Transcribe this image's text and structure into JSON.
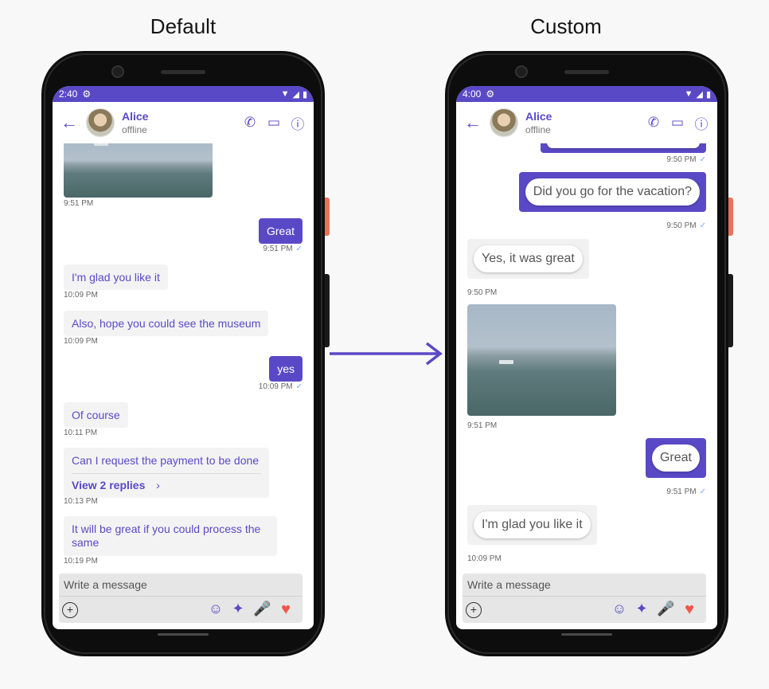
{
  "labels": {
    "left": "Default",
    "right": "Custom"
  },
  "colors": {
    "accent": "#5a49c6",
    "heart": "#f45448",
    "tick": "#7aa7ff"
  },
  "default": {
    "status_time": "2:40",
    "header": {
      "name": "Alice",
      "status": "offline"
    },
    "messages": {
      "img_time": "9:51 PM",
      "great": "Great",
      "great_time": "9:51 PM",
      "glad": "I'm glad you like it",
      "glad_time": "10:09 PM",
      "museum": "Also, hope you could see the museum",
      "museum_time": "10:09 PM",
      "yes": "yes",
      "yes_time": "10:09 PM",
      "course": "Of course",
      "course_time": "10:11 PM",
      "payment": "Can I request the payment to be done",
      "replies": "View 2 replies",
      "payment_time": "10:13 PM",
      "process": "It will be great if you could process the same",
      "process_time": "10:19 PM"
    },
    "composer": {
      "placeholder": "Write a message"
    }
  },
  "custom": {
    "status_time": "4:00",
    "header": {
      "name": "Alice",
      "status": "offline"
    },
    "messages": {
      "top_time": "9:50 PM",
      "vacation": "Did you go for the vacation?",
      "vacation_time": "9:50 PM",
      "yes_great": "Yes, it was great",
      "yes_great_time": "9:50 PM",
      "img_time": "9:51 PM",
      "great": "Great",
      "great_time": "9:51 PM",
      "glad": "I'm glad you like it",
      "glad_time": "10:09 PM"
    },
    "composer": {
      "placeholder": "Write a message"
    }
  }
}
